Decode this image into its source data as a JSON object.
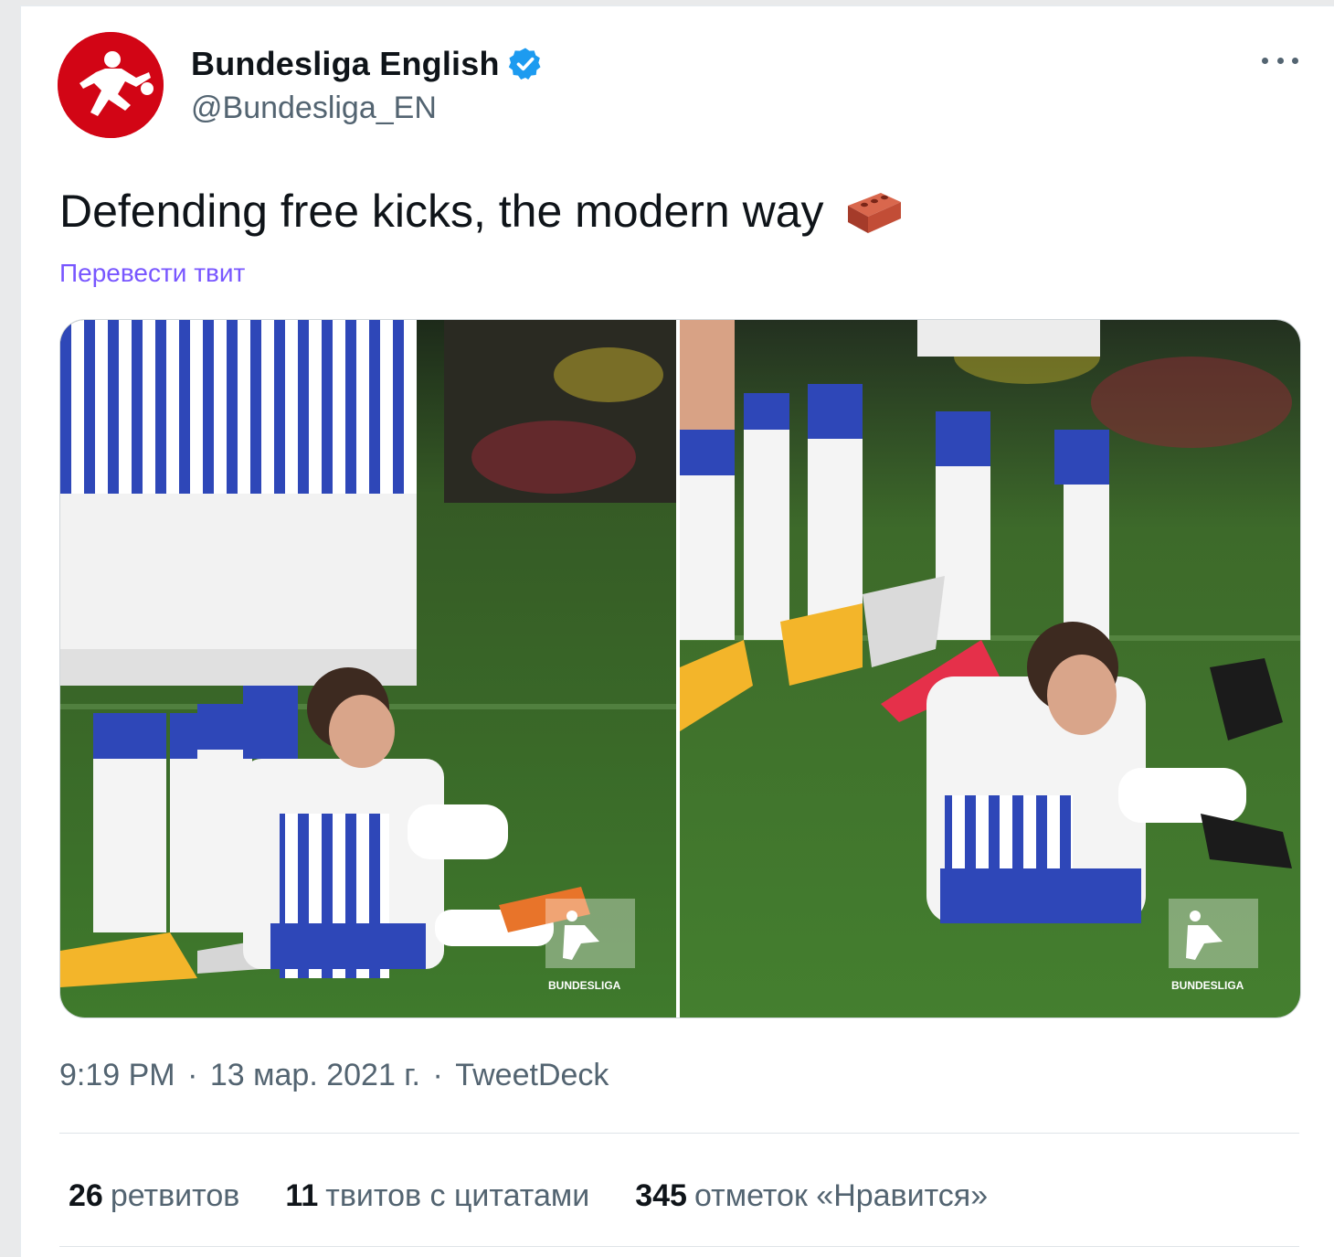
{
  "author": {
    "display_name": "Bundesliga English",
    "handle": "@Bundesliga_EN",
    "verified": true,
    "avatar_color": "#d20515"
  },
  "tweet": {
    "text": "Defending free kicks, the modern way",
    "emoji_icon": "brick-icon",
    "translate_label": "Перевести твит"
  },
  "media": {
    "photos": [
      {
        "watermark": "BUNDESLIGA"
      },
      {
        "watermark": "BUNDESLIGA"
      }
    ]
  },
  "meta": {
    "time": "9:19 PM",
    "date": "13 мар. 2021 г.",
    "separator": "·",
    "source": "TweetDeck"
  },
  "stats": {
    "retweets_count": "26",
    "retweets_label": "ретвитов",
    "quotes_count": "11",
    "quotes_label": "твитов с цитатами",
    "likes_count": "345",
    "likes_label": "отметок «Нравится»"
  },
  "colors": {
    "link": "#7856ff",
    "secondary_text": "#536471",
    "verified_badge": "#1d9bf0",
    "pitch_green": "#3f7a2c"
  }
}
